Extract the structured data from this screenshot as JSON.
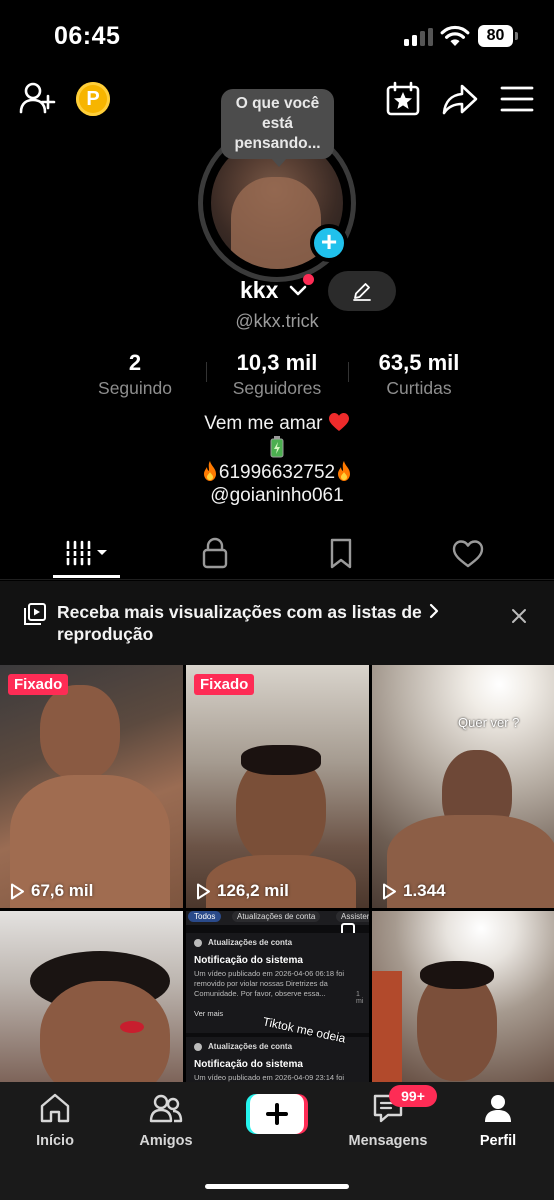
{
  "status_bar": {
    "time": "06:45",
    "battery": "80"
  },
  "profile": {
    "bubble_text_1": "O que você",
    "bubble_text_2": "está",
    "bubble_text_3": "pensando...",
    "name": "kkx",
    "handle": "@kkx.trick"
  },
  "stats": [
    {
      "value": "2",
      "label": "Seguindo"
    },
    {
      "value": "10,3 mil",
      "label": "Seguidores"
    },
    {
      "value": "63,5 mil",
      "label": "Curtidas"
    }
  ],
  "bio": {
    "line1": "Vem me amar",
    "line3": "61996632752",
    "line4": "@goianinho061"
  },
  "promo": {
    "text": "Receba mais visualizações com as listas de reprodução"
  },
  "videos": [
    {
      "pinned": "Fixado",
      "views": "67,6 mil"
    },
    {
      "pinned": "Fixado",
      "views": "126,2 mil"
    },
    {
      "views": "1.344",
      "overlay": "Quer ver ?"
    },
    {},
    {
      "tab_all": "Todos",
      "tab_updates": "Atualizações de conta",
      "tab_assist": "Assisten",
      "notif_header": "Atualizações de conta",
      "notif_title": "Notificação do sistema",
      "notif_body": "Um vídeo publicado em 2026-04-06 06:18 foi removido por violar nossas Diretrizes da Comunidade. Por favor, observe essa...",
      "notif_more": "Ver mais",
      "notif_time": "1 mi",
      "notif_header2": "Atualizações de conta",
      "notif_title2": "Notificação do sistema",
      "notif_body2": "Um vídeo publicado em 2026-04-09 23:14 foi",
      "overlay": "Tiktok me odeia"
    },
    {}
  ],
  "nav": {
    "home": "Início",
    "friends": "Amigos",
    "messages": "Mensagens",
    "messages_badge": "99+",
    "profile": "Perfil"
  },
  "colors": {
    "accent_red": "#fe2c55",
    "accent_cyan": "#20c1ec",
    "coin": "#f7b500"
  }
}
